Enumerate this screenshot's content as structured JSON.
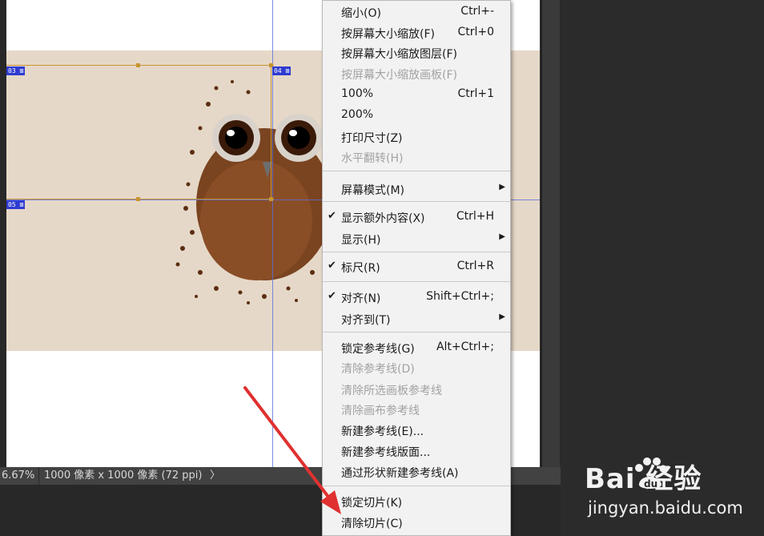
{
  "status_bar": {
    "zoom": "6.67%",
    "doc_info": "1000 像素 x 1000 像素 (72 ppi)",
    "arrow": "〉"
  },
  "slices": [
    "03",
    "04",
    "05"
  ],
  "menu": {
    "items": [
      {
        "label": "缩小(O)",
        "shortcut": "Ctrl+-"
      },
      {
        "label": "按屏幕大小缩放(F)",
        "shortcut": "Ctrl+0"
      },
      {
        "label": "按屏幕大小缩放图层(F)",
        "shortcut": ""
      },
      {
        "label": "按屏幕大小缩放画板(F)",
        "shortcut": ""
      },
      {
        "label": "100%",
        "shortcut": "Ctrl+1"
      },
      {
        "label": "200%",
        "shortcut": ""
      },
      {
        "label": "打印尺寸(Z)",
        "shortcut": ""
      },
      {
        "label": "水平翻转(H)",
        "shortcut": ""
      },
      {
        "label": "屏幕模式(M)",
        "shortcut": ""
      },
      {
        "label": "显示额外内容(X)",
        "shortcut": "Ctrl+H"
      },
      {
        "label": "显示(H)",
        "shortcut": ""
      },
      {
        "label": "标尺(R)",
        "shortcut": "Ctrl+R"
      },
      {
        "label": "对齐(N)",
        "shortcut": "Shift+Ctrl+;"
      },
      {
        "label": "对齐到(T)",
        "shortcut": ""
      },
      {
        "label": "锁定参考线(G)",
        "shortcut": "Alt+Ctrl+;"
      },
      {
        "label": "清除参考线(D)",
        "shortcut": ""
      },
      {
        "label": "清除所选画板参考线",
        "shortcut": ""
      },
      {
        "label": "清除画布参考线",
        "shortcut": ""
      },
      {
        "label": "新建参考线(E)...",
        "shortcut": ""
      },
      {
        "label": "新建参考线版面...",
        "shortcut": ""
      },
      {
        "label": "通过形状新建参考线(A)",
        "shortcut": ""
      },
      {
        "label": "锁定切片(K)",
        "shortcut": ""
      },
      {
        "label": "清除切片(C)",
        "shortcut": ""
      }
    ],
    "check_mark": "✔",
    "submenu_arrow": "▶"
  },
  "watermark": {
    "logo": "Bai  经验",
    "url": "jingyan.baidu.com"
  },
  "colors": {
    "annotation_arrow": "#e03030",
    "slice_line": "#c89432",
    "guide": "#5a6fdc",
    "menu_bg": "#f2f2f2"
  }
}
